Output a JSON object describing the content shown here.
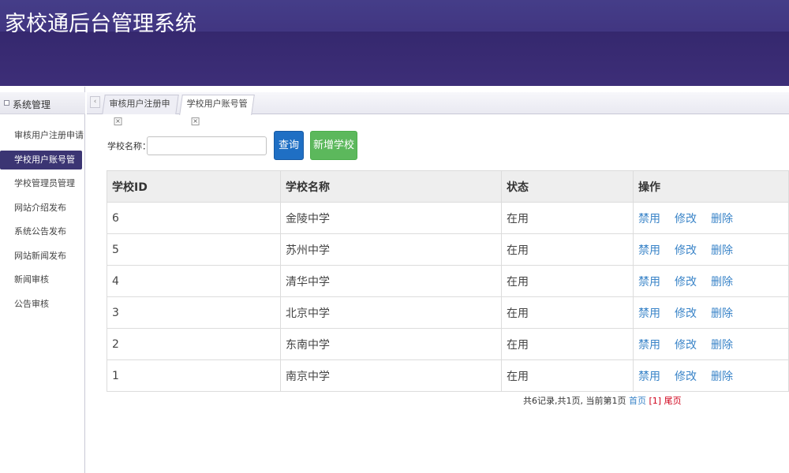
{
  "header": {
    "title": "家校通后台管理系统"
  },
  "sidebar": {
    "section_title": "系统管理",
    "items": [
      {
        "label": "审核用户注册申请"
      },
      {
        "label": "学校用户账号管理"
      },
      {
        "label": "学校管理员管理"
      },
      {
        "label": "网站介绍发布"
      },
      {
        "label": "系统公告发布"
      },
      {
        "label": "网站新闻发布"
      },
      {
        "label": "新闻审核"
      },
      {
        "label": "公告审核"
      }
    ],
    "active_index": 1
  },
  "tabs": [
    {
      "label": "审核用户注册申",
      "close": "×"
    },
    {
      "label": "学校用户账号管",
      "close": "×"
    }
  ],
  "tab_scroll_left": "‹",
  "search": {
    "label": "学校名称：",
    "value": "",
    "placeholder": ""
  },
  "buttons": {
    "query": "查询",
    "add": "新增学校"
  },
  "table": {
    "headers": [
      "学校ID",
      "学校名称",
      "状态",
      "操作"
    ],
    "rows": [
      {
        "id": "6",
        "name": "金陵中学",
        "status": "在用"
      },
      {
        "id": "5",
        "name": "苏州中学",
        "status": "在用"
      },
      {
        "id": "4",
        "name": "清华中学",
        "status": "在用"
      },
      {
        "id": "3",
        "name": "北京中学",
        "status": "在用"
      },
      {
        "id": "2",
        "name": "东南中学",
        "status": "在用"
      },
      {
        "id": "1",
        "name": "南京中学",
        "status": "在用"
      }
    ],
    "actions": {
      "disable": "禁用",
      "edit": "修改",
      "delete": "删除"
    }
  },
  "pager": {
    "summary": "共6记录,共1页, 当前第1页",
    "first": "首页",
    "current": "[1]",
    "last": "尾页"
  },
  "colors": {
    "header": "#3b2c74",
    "active_side": "#3b3573",
    "query": "#1f6fc4",
    "add": "#5cb85c",
    "link": "#3a84c8"
  }
}
